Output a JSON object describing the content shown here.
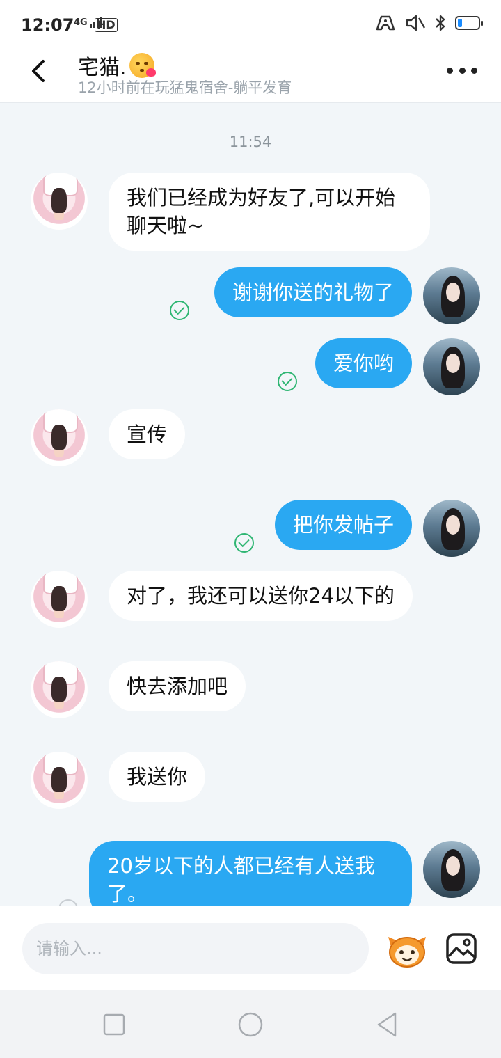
{
  "status": {
    "time": "12:07",
    "network": "4G",
    "hd": "HD",
    "battery_percent": 20,
    "icons": [
      "game-mode-icon",
      "mute-icon",
      "bluetooth-icon",
      "battery-icon"
    ]
  },
  "header": {
    "title": "宅猫.",
    "title_emoji": "kiss-face-emoji",
    "subtitle": "12小时前在玩猛鬼宿舍-躺平发育",
    "icons": [
      "back-arrow-icon",
      "more-dots-icon"
    ]
  },
  "chat": {
    "time_divider": "11:54",
    "messages": [
      {
        "dir": "in",
        "text": "我们已经成为好友了,可以开始聊天啦~"
      },
      {
        "dir": "out",
        "text": "谢谢你送的礼物了",
        "status": "read"
      },
      {
        "dir": "out",
        "text": "爱你哟",
        "status": "read"
      },
      {
        "dir": "in",
        "text": "宣传"
      },
      {
        "dir": "out",
        "text": "把你发帖子",
        "status": "read"
      },
      {
        "dir": "in",
        "text": "对了，我还可以送你24以下的"
      },
      {
        "dir": "in",
        "text": "快去添加吧"
      },
      {
        "dir": "in",
        "text": "我送你"
      },
      {
        "dir": "out",
        "text": "20岁以下的人都已经有人送我了。",
        "status": "sending"
      }
    ]
  },
  "input": {
    "placeholder": "请输入...",
    "value": "",
    "icons": [
      "sticker-mascot-icon",
      "image-picker-icon"
    ]
  },
  "navbar": {
    "icons": [
      "recent-apps-icon",
      "home-icon",
      "back-triangle-icon"
    ]
  },
  "colors": {
    "outgoing_bubble": "#2aa8f2",
    "incoming_bubble": "#ffffff",
    "chat_background": "#f2f6f9",
    "read_check": "#2fb673"
  }
}
